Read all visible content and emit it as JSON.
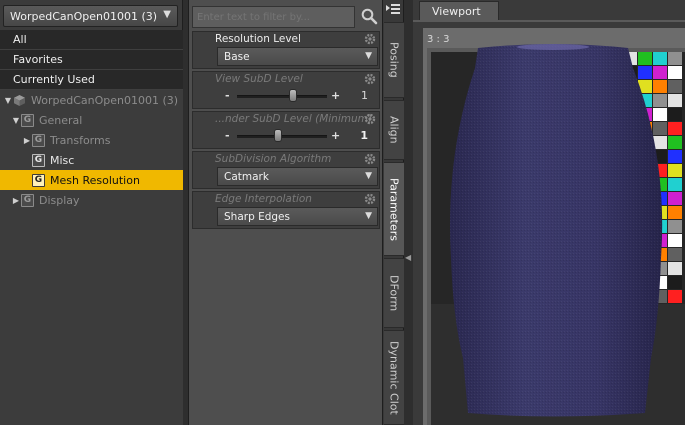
{
  "scene": {
    "node_selector": "WorpedCanOpen01001 (3)",
    "categories": [
      "All",
      "Favorites",
      "Currently Used"
    ],
    "tree": [
      {
        "label": "WorpedCanOpen01001 (3)",
        "kind": "figure",
        "expander": "▼",
        "depth": 0,
        "state": "dim"
      },
      {
        "label": "General",
        "kind": "group",
        "expander": "▼",
        "depth": 1,
        "state": "dim"
      },
      {
        "label": "Transforms",
        "kind": "group",
        "expander": "▶",
        "depth": 2,
        "state": "dim"
      },
      {
        "label": "Misc",
        "kind": "group",
        "expander": "",
        "depth": 2,
        "state": "normal"
      },
      {
        "label": "Mesh Resolution",
        "kind": "group",
        "expander": "",
        "depth": 2,
        "state": "selected"
      },
      {
        "label": "Display",
        "kind": "group",
        "expander": "▶",
        "depth": 1,
        "state": "dim"
      }
    ],
    "group_glyph": "G"
  },
  "params": {
    "filter_placeholder": "Enter text to filter by...",
    "resolution_level": {
      "title": "Resolution Level",
      "value": "Base"
    },
    "view_subd": {
      "title": "View SubD Level",
      "minus": "-",
      "plus": "+",
      "value": "1",
      "level": 0.62
    },
    "render_subd": {
      "title": "...nder SubD Level (Minimum)",
      "minus": "-",
      "plus": "+",
      "value": "1",
      "level": 0.45
    },
    "subd_algorithm": {
      "title": "SubDivision Algorithm",
      "value": "Catmark"
    },
    "edge_interpolation": {
      "title": "Edge Interpolation",
      "value": "Sharp Edges"
    }
  },
  "tabs": [
    "Posing",
    "Align",
    "Parameters",
    "DForm",
    "Dynamic Clot"
  ],
  "viewport": {
    "tab_label": "Viewport",
    "view_label": "3 : 3"
  },
  "colors": {
    "selection": "#f0b800",
    "mesh": "#3a3866",
    "background": "#696969"
  }
}
